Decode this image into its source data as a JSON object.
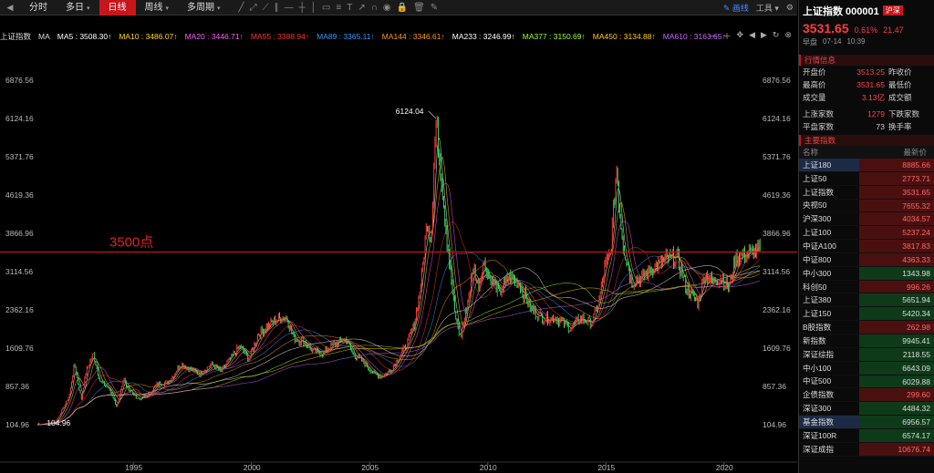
{
  "topbar": {
    "tabs": [
      {
        "label": "分时",
        "active": false,
        "caret": false
      },
      {
        "label": "多日",
        "active": false,
        "caret": true
      },
      {
        "label": "日线",
        "active": true,
        "caret": false
      },
      {
        "label": "周线",
        "active": false,
        "caret": true
      },
      {
        "label": "多周期",
        "active": false,
        "caret": true
      }
    ],
    "draw_label": "画线",
    "tools_label": "工具"
  },
  "ma_bar": {
    "label": "上证指数",
    "ma_name": "MA",
    "items": [
      {
        "text": "MA5 : 3508.30↑",
        "color": "#ffffff"
      },
      {
        "text": "MA10 : 3486.07↑",
        "color": "#ffd700"
      },
      {
        "text": "MA20 : 3446.71↑",
        "color": "#ff5cff"
      },
      {
        "text": "MA55 : 3388.94↑",
        "color": "#ff3333"
      },
      {
        "text": "MA89 : 3365.11↑",
        "color": "#3399ff"
      },
      {
        "text": "MA144 : 3346.61↑",
        "color": "#ff9900"
      },
      {
        "text": "MA233 : 3246.99↑",
        "color": "#ffffff"
      },
      {
        "text": "MA377 : 3150.69↑",
        "color": "#99ff33"
      },
      {
        "text": "MA450 : 3134.88↑",
        "color": "#ffcc00"
      },
      {
        "text": "MA610 : 3163.65↑",
        "color": "#cc66ff"
      }
    ]
  },
  "chart_data": {
    "type": "line",
    "yticks": [
      "6876.56",
      "6124.16",
      "5371.76",
      "4619.36",
      "3866.96",
      "3114.56",
      "2362.16",
      "1609.76",
      "857.36",
      "104.96"
    ],
    "ylim": [
      104.96,
      6876.56
    ],
    "xticks": [
      "1995",
      "2000",
      "2005",
      "2010",
      "2015",
      "2020"
    ],
    "xlim": [
      1990.9,
      2021.55
    ],
    "annotations": [
      {
        "text": "6124.04",
        "x": 2007.8,
        "y": 6124.04
      },
      {
        "text": "104.96",
        "x": 1990.95,
        "y": 104.96
      }
    ],
    "hline": {
      "label": "3500点",
      "y": 3500,
      "color": "#cc1111"
    },
    "series": [
      {
        "x": [
          1990.95,
          1991.3,
          1991.7,
          1992.0,
          1992.3,
          1992.5,
          1992.8,
          1993.0,
          1993.3,
          1993.6,
          1994.0,
          1994.3,
          1994.6,
          1994.8,
          1995.2,
          1995.6,
          1996.0,
          1996.5,
          1997.0,
          1997.4,
          1997.8,
          1998.3,
          1998.7,
          1999.1,
          1999.5,
          1999.9,
          2000.3,
          2000.6,
          2001.0,
          2001.45,
          2001.8,
          2002.2,
          2002.6,
          2003.0,
          2003.5,
          2004.0,
          2004.3,
          2004.8,
          2005.2,
          2005.5,
          2005.9,
          2006.3,
          2006.6,
          2006.9,
          2007.2,
          2007.45,
          2007.6,
          2007.8,
          2008.0,
          2008.3,
          2008.6,
          2008.85,
          2009.1,
          2009.4,
          2009.6,
          2009.8,
          2010.1,
          2010.5,
          2010.9,
          2011.3,
          2011.8,
          2012.3,
          2012.9,
          2013.5,
          2013.9,
          2014.4,
          2014.7,
          2014.95,
          2015.2,
          2015.45,
          2015.6,
          2015.75,
          2016.1,
          2016.5,
          2017.0,
          2017.5,
          2018.0,
          2018.4,
          2018.9,
          2019.2,
          2019.5,
          2019.9,
          2020.2,
          2020.5,
          2020.9,
          2021.2,
          2021.54
        ],
        "values": [
          105,
          130,
          160,
          400,
          700,
          1300,
          600,
          1150,
          1500,
          950,
          800,
          450,
          1000,
          800,
          600,
          680,
          900,
          950,
          1300,
          1200,
          1100,
          1300,
          1150,
          1400,
          1650,
          1400,
          1900,
          2000,
          2150,
          2240,
          1800,
          1750,
          1550,
          1500,
          1700,
          1780,
          1500,
          1300,
          1100,
          1050,
          1180,
          1480,
          1700,
          2100,
          3000,
          4200,
          3700,
          6124,
          5200,
          3600,
          2300,
          1800,
          2400,
          3200,
          2800,
          3300,
          3000,
          2700,
          3000,
          2900,
          2400,
          2200,
          2200,
          2000,
          2200,
          2100,
          2500,
          3200,
          3500,
          5178,
          4200,
          3600,
          2900,
          3000,
          3200,
          3350,
          3400,
          2800,
          2500,
          3100,
          2900,
          3000,
          2800,
          3400,
          3450,
          3500,
          3531.65
        ]
      }
    ]
  },
  "panel": {
    "title": "上证指数 000001",
    "badge": "沪深",
    "price": "3531.65",
    "change_pct": "0.61%",
    "change": "21.47",
    "date_prefix": "早盘",
    "date": "07-14",
    "time": "10:39",
    "info_title": "行情信息",
    "info": [
      {
        "k": "开盘价",
        "v": "3513.25",
        "k2": "昨收价",
        "plain": false
      },
      {
        "k": "最高价",
        "v": "3531.65",
        "k2": "最低价",
        "plain": false
      },
      {
        "k": "成交量",
        "v": "3.13亿",
        "k2": "成交额",
        "plain": false
      }
    ],
    "info2": [
      {
        "k": "上涨家数",
        "v": "1279",
        "k2": "下跌家数",
        "plain": false
      },
      {
        "k": "平盘家数",
        "v": "73",
        "k2": "换手率",
        "plain": true
      }
    ],
    "index_title": "主要指数",
    "index_head": {
      "name": "名称",
      "price": "最新价"
    },
    "indices": [
      {
        "name": "上证180",
        "price": "8885.66",
        "dir": "up",
        "sel": true
      },
      {
        "name": "上证50",
        "price": "2773.71",
        "dir": "up",
        "sel": false
      },
      {
        "name": "上证指数",
        "price": "3531.65",
        "dir": "up",
        "sel": false
      },
      {
        "name": "央视50",
        "price": "7655.32",
        "dir": "up",
        "sel": false
      },
      {
        "name": "沪深300",
        "price": "4034.57",
        "dir": "up",
        "sel": false
      },
      {
        "name": "上证100",
        "price": "5237.24",
        "dir": "up",
        "sel": false
      },
      {
        "name": "中证A100",
        "price": "3817.83",
        "dir": "up",
        "sel": false
      },
      {
        "name": "中证800",
        "price": "4363.33",
        "dir": "up",
        "sel": false
      },
      {
        "name": "中小300",
        "price": "1343.98",
        "dir": "down",
        "sel": false
      },
      {
        "name": "科创50",
        "price": "996.26",
        "dir": "up",
        "sel": false
      },
      {
        "name": "上证380",
        "price": "5651.94",
        "dir": "down",
        "sel": false
      },
      {
        "name": "上证150",
        "price": "5420.34",
        "dir": "down",
        "sel": false
      },
      {
        "name": "B股指数",
        "price": "262.98",
        "dir": "up",
        "sel": false
      },
      {
        "name": "新指数",
        "price": "9945.41",
        "dir": "down",
        "sel": false
      },
      {
        "name": "深证综指",
        "price": "2118.55",
        "dir": "down",
        "sel": false
      },
      {
        "name": "中小100",
        "price": "6643.09",
        "dir": "down",
        "sel": false
      },
      {
        "name": "中证500",
        "price": "6029.88",
        "dir": "down",
        "sel": false
      },
      {
        "name": "企债指数",
        "price": "299.60",
        "dir": "up",
        "sel": false
      },
      {
        "name": "深证300",
        "price": "4484.32",
        "dir": "down",
        "sel": false
      },
      {
        "name": "基金指数",
        "price": "6956.57",
        "dir": "down",
        "sel": true
      },
      {
        "name": "深证100R",
        "price": "6574.17",
        "dir": "down",
        "sel": false
      },
      {
        "name": "深证成指",
        "price": "10676.74",
        "dir": "up",
        "sel": false
      }
    ]
  }
}
